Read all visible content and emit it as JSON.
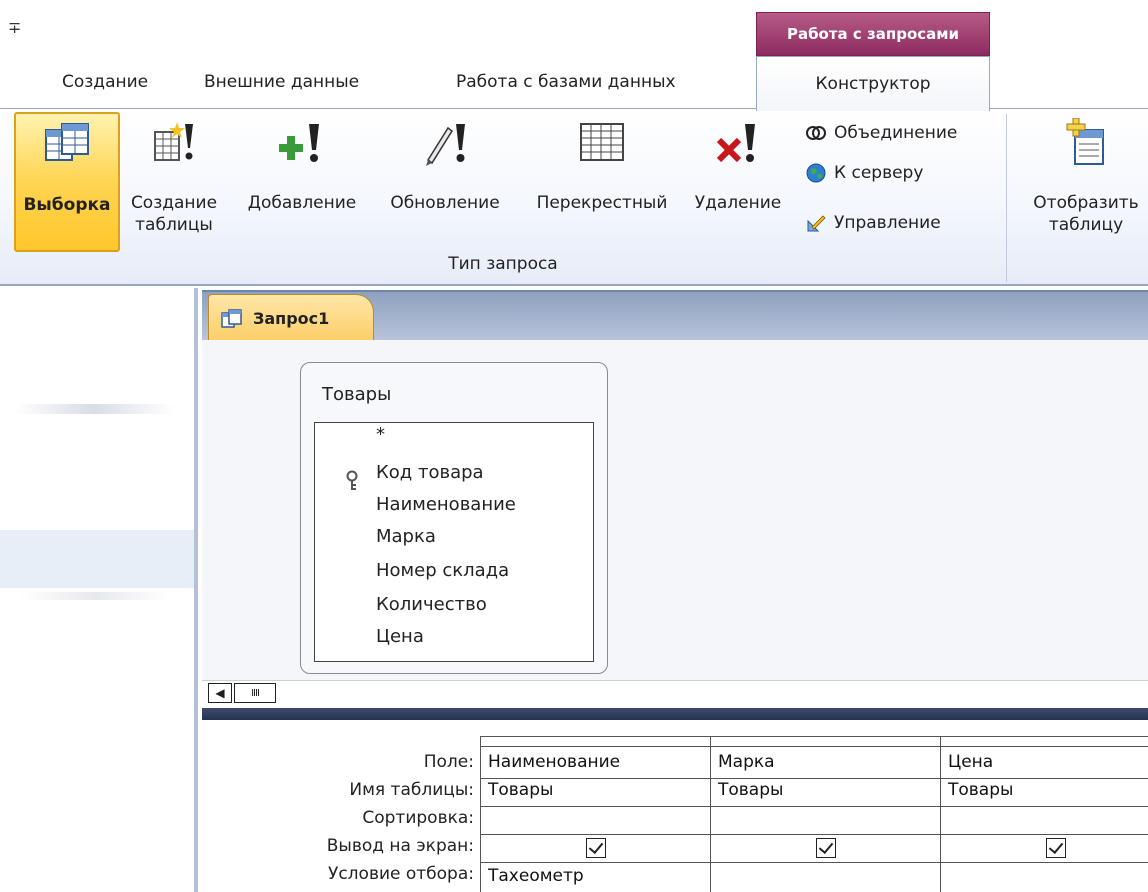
{
  "qat": {
    "glyph": "∓"
  },
  "contextual_header": "Работа с запросами",
  "tabs": [
    "Создание",
    "Внешние данные",
    "Работа с базами данных"
  ],
  "active_tab": "Конструктор",
  "ribbon": {
    "buttons": [
      {
        "id": "select",
        "label": "Выборка",
        "active": true
      },
      {
        "id": "make_table",
        "label": "Создание\nтаблицы"
      },
      {
        "id": "append",
        "label": "Добавление"
      },
      {
        "id": "update",
        "label": "Обновление"
      },
      {
        "id": "crosstab",
        "label": "Перекрестный"
      },
      {
        "id": "delete",
        "label": "Удаление"
      }
    ],
    "small_buttons": [
      "Объединение",
      "К серверу",
      "Управление"
    ],
    "show_table": "Отобразить\nтаблицу",
    "group_label": "Тип запроса"
  },
  "document_tab": "Запрос1",
  "table_box": {
    "title": "Товары",
    "fields": [
      "*",
      "Код товара",
      "Наименование",
      "Марка",
      "Номер склада",
      "Количество",
      "Цена"
    ]
  },
  "scroll": {
    "left_arrow": "◀",
    "thumb": "IIII"
  },
  "grid": {
    "row_labels": [
      "Поле:",
      "Имя таблицы:",
      "Сортировка:",
      "Вывод на экран:",
      "Условие отбора:"
    ],
    "columns": [
      {
        "field": "Наименование",
        "table": "Товары",
        "sort": "",
        "show": true,
        "criteria": "Тахеометр"
      },
      {
        "field": "Марка",
        "table": "Товары",
        "sort": "",
        "show": true,
        "criteria": ""
      },
      {
        "field": "Цена",
        "table": "Товары",
        "sort": "",
        "show": true,
        "criteria": ""
      }
    ]
  }
}
